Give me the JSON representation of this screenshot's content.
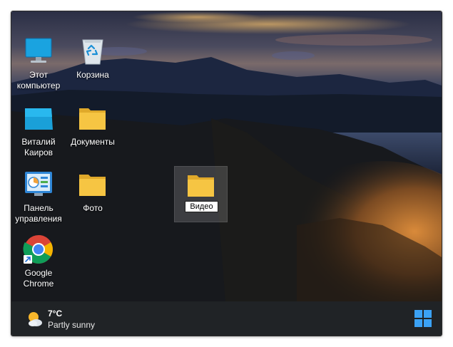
{
  "desktop": {
    "icons": [
      {
        "label": "Этот\nкомпьютер"
      },
      {
        "label": "Корзина"
      },
      {
        "label": "Виталий\nКаиров"
      },
      {
        "label": "Документы"
      },
      {
        "label": "Панель\nуправления"
      },
      {
        "label": "Фото"
      },
      {
        "label": "Google\nChrome"
      }
    ],
    "selected_folder": {
      "rename_value": "Видео"
    }
  },
  "taskbar": {
    "weather": {
      "temp": "7°C",
      "description": "Partly sunny",
      "icon": "partly-sunny-icon"
    },
    "start_icon": "windows-start-icon"
  },
  "colors": {
    "taskbar": "#202326",
    "folder": "#f6c543",
    "accent": "#1e90ff"
  }
}
